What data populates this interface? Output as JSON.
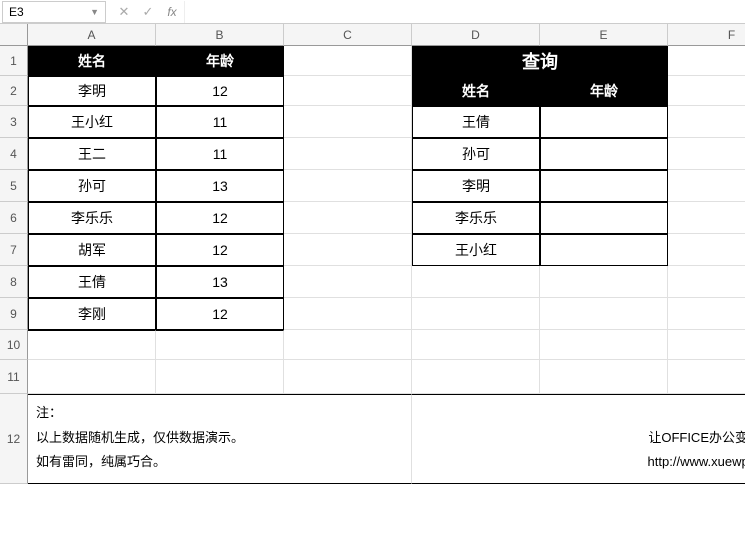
{
  "formula_bar": {
    "cell_ref": "E3",
    "cancel_icon": "✕",
    "confirm_icon": "✓",
    "fx_label": "fx",
    "formula_value": ""
  },
  "columns": [
    "A",
    "B",
    "C",
    "D",
    "E",
    "F"
  ],
  "rows": [
    "1",
    "2",
    "3",
    "4",
    "5",
    "6",
    "7",
    "8",
    "9",
    "10",
    "11",
    "12"
  ],
  "left_table": {
    "headers": {
      "name": "姓名",
      "age": "年龄"
    },
    "rows": [
      {
        "name": "李明",
        "age": "12"
      },
      {
        "name": "王小红",
        "age": "11"
      },
      {
        "name": "王二",
        "age": "11"
      },
      {
        "name": "孙可",
        "age": "13"
      },
      {
        "name": "李乐乐",
        "age": "12"
      },
      {
        "name": "胡军",
        "age": "12"
      },
      {
        "name": "王倩",
        "age": "13"
      },
      {
        "name": "李刚",
        "age": "12"
      }
    ]
  },
  "query": {
    "title": "查询",
    "headers": {
      "name": "姓名",
      "age": "年龄"
    },
    "rows": [
      {
        "name": "王倩",
        "age": ""
      },
      {
        "name": "孙可",
        "age": ""
      },
      {
        "name": "李明",
        "age": ""
      },
      {
        "name": "李乐乐",
        "age": ""
      },
      {
        "name": "王小红",
        "age": ""
      }
    ]
  },
  "note_left": "注：\n以上数据随机生成，仅供数据演示。\n如有雷同，纯属巧合。",
  "note_right": "学WPS\n让OFFICE办公变得简单\nhttp://www.xuewps.com/",
  "active_cell": "E3"
}
